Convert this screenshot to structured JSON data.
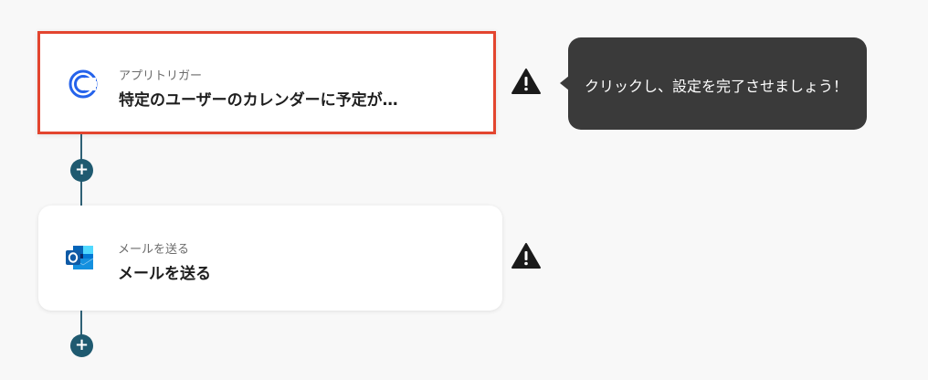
{
  "steps": [
    {
      "subtitle": "アプリトリガー",
      "title": "特定のユーザーのカレンダーに予定が…",
      "icon": "calendar-app-icon",
      "selected": true
    },
    {
      "subtitle": "メールを送る",
      "title": "メールを送る",
      "icon": "outlook-icon",
      "selected": false
    }
  ],
  "tooltip": {
    "text": "クリックし、設定を完了させましょう！"
  },
  "add_button_label": "+",
  "colors": {
    "selected_border": "#e3452f",
    "connector": "#1f5a70",
    "tooltip_bg": "#3a3a3a",
    "warning": "#1a1a1a"
  }
}
